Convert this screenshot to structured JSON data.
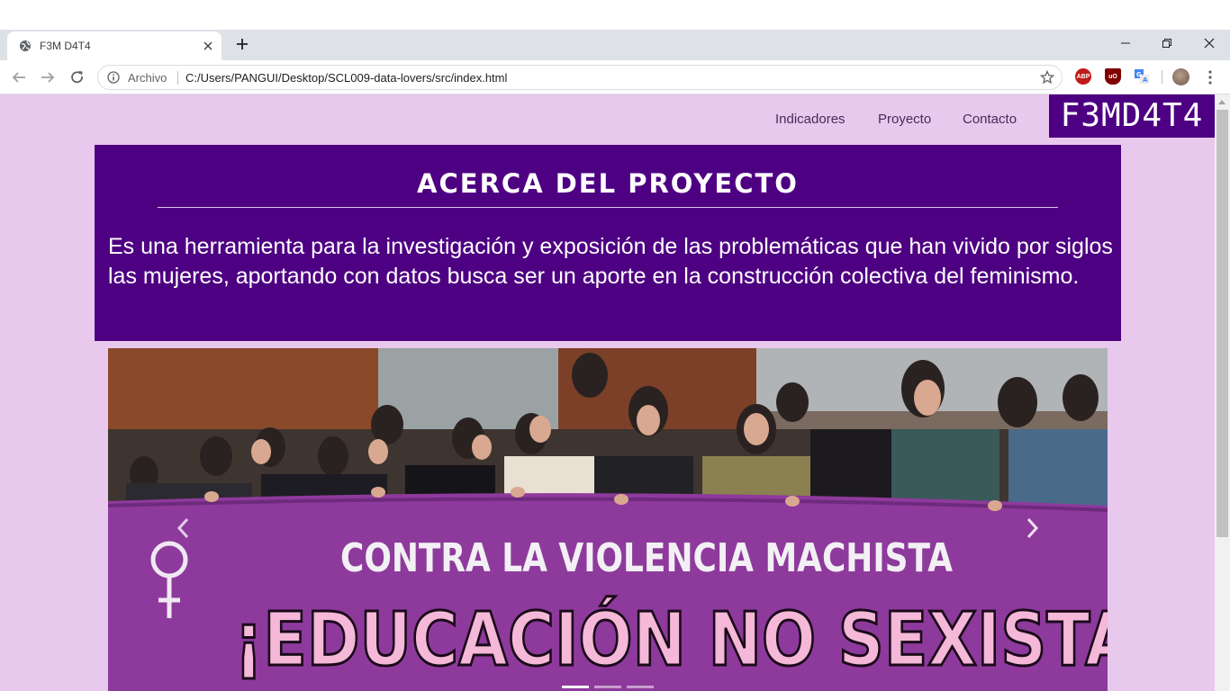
{
  "browser": {
    "tab": {
      "title": "F3M D4T4",
      "favicon": "globe-icon"
    },
    "address": {
      "scheme_label": "Archivo",
      "url": "C:/Users/PANGUI/Desktop/SCL009-data-lovers/src/index.html"
    },
    "extensions": [
      "abp-icon",
      "ublock-icon",
      "translate-icon"
    ]
  },
  "site": {
    "nav": {
      "links": [
        "Indicadores",
        "Proyecto",
        "Contacto"
      ],
      "brand": "F3MD4T4"
    },
    "about": {
      "title": "ACERCA DEL PROYECTO",
      "text": "Es una herramienta para la investigación y exposición de las problemáticas que han vivido por siglos las mujeres, aportando con datos busca ser un aporte en la construcción colectiva del feminismo."
    },
    "carousel": {
      "banner_line1": "CONTRA LA VIOLENCIA MACHISTA",
      "banner_line2": "¡EDUCACIÓN NO SEXISTA",
      "slides": 3,
      "active_slide": 1
    }
  },
  "colors": {
    "page_bg": "#e8c8ec",
    "accent": "#4e0082",
    "banner": "#8e3a9c"
  }
}
